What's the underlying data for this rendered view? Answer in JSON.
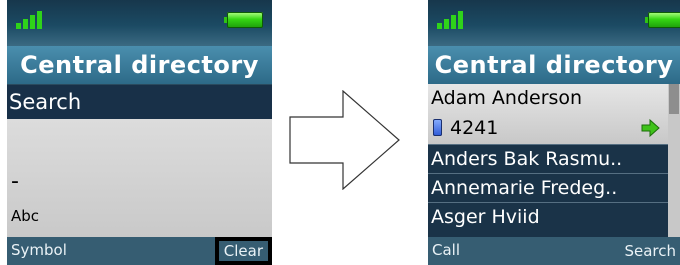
{
  "left": {
    "title": "Central directory",
    "search_header": "Search",
    "search_value": "-",
    "input_mode": "Abc",
    "softkey_left": "Symbol",
    "softkey_right": "Clear"
  },
  "right": {
    "title": "Central directory",
    "selected": {
      "name": "Adam Anderson",
      "number": "4241"
    },
    "entries": [
      "Anders Bak Rasmu..",
      "Annemarie Fredeg..",
      "Asger Hviid"
    ],
    "softkey_left": "Call",
    "softkey_right": "Search"
  },
  "colors": {
    "signal": "#2fd31a",
    "battery": "#35d613",
    "title": "#2d6a88",
    "selection": "#183048"
  },
  "icons": [
    "signal-icon",
    "battery-icon",
    "phone-icon",
    "call-arrow-icon",
    "transition-arrow"
  ]
}
